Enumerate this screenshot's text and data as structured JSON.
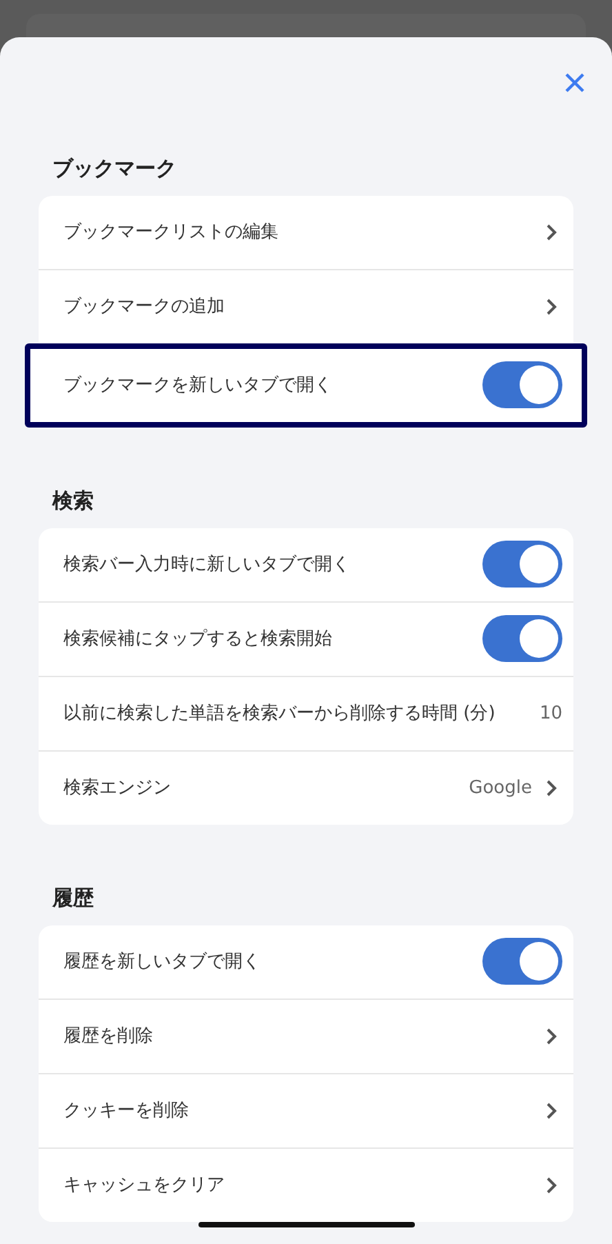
{
  "sections": [
    {
      "title": "ブックマーク",
      "rows": [
        {
          "kind": "link",
          "label": "ブックマークリストの編集",
          "highlighted": false
        },
        {
          "kind": "link",
          "label": "ブックマークの追加",
          "highlighted": false
        },
        {
          "kind": "toggle",
          "label": "ブックマークを新しいタブで開く",
          "on": true,
          "highlighted": true
        }
      ]
    },
    {
      "title": "検索",
      "rows": [
        {
          "kind": "toggle",
          "label": "検索バー入力時に新しいタブで開く",
          "on": true,
          "highlighted": false
        },
        {
          "kind": "toggle",
          "label": "検索候補にタップすると検索開始",
          "on": true,
          "highlighted": false
        },
        {
          "kind": "value",
          "label": "以前に検索した単語を検索バーから削除する時間 (分)",
          "value": "10",
          "highlighted": false
        },
        {
          "kind": "link",
          "label": "検索エンジン",
          "value": "Google",
          "highlighted": false
        }
      ]
    },
    {
      "title": "履歴",
      "rows": [
        {
          "kind": "toggle",
          "label": "履歴を新しいタブで開く",
          "on": true,
          "highlighted": false
        },
        {
          "kind": "link",
          "label": "履歴を削除",
          "highlighted": false
        },
        {
          "kind": "link",
          "label": "クッキーを削除",
          "highlighted": false
        },
        {
          "kind": "link",
          "label": "キャッシュをクリア",
          "highlighted": false
        }
      ]
    }
  ]
}
